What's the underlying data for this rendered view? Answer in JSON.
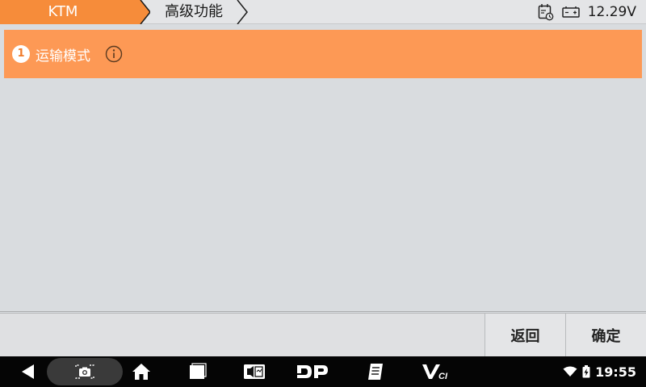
{
  "topbar": {
    "breadcrumb": [
      "KTM",
      "高级功能"
    ],
    "voltage": "12.29V",
    "calendar_icon": "calendar-clock-icon",
    "battery_icon": "battery-icon"
  },
  "list": {
    "items": [
      {
        "number": "1",
        "label": "运输模式",
        "icon": "info-icon"
      }
    ]
  },
  "actions": {
    "back_label": "返回",
    "ok_label": "确定"
  },
  "navbar": {
    "icons": [
      "back-icon",
      "screenshot-icon",
      "home-icon",
      "recent-apps-icon",
      "media-icon",
      "dp-icon",
      "notes-icon",
      "vci-icon"
    ],
    "dp_label": "DP",
    "vci_label": "VCI",
    "time": "19:55"
  },
  "colors": {
    "accent": "#f68c3a",
    "selected_row": "#fd9955"
  }
}
